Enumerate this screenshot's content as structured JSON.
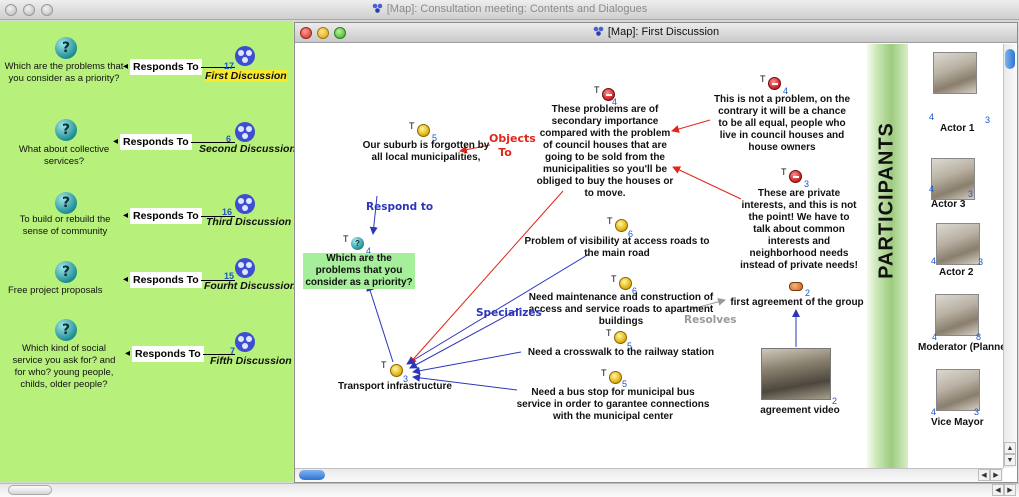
{
  "outer_window": {
    "title": "[Map]: Consultation meeting: Contents and Dialogues"
  },
  "left_panel": {
    "rows": [
      {
        "question": "Which are the problems that you consider as a priority?",
        "link": "Responds To",
        "count": "17",
        "discussion": "First Discussion",
        "highlighted": true
      },
      {
        "question": "What about collective services?",
        "link": "Responds To",
        "count": "6",
        "discussion": "Second Discussion",
        "highlighted": false
      },
      {
        "question": "To build or rebuild the sense of community",
        "link": "Responds To",
        "count": "16",
        "discussion": "Third Discussion",
        "highlighted": false
      },
      {
        "question": "Free project proposals",
        "link": "Responds To",
        "count": "15",
        "discussion": "Fourht Discussion",
        "highlighted": false
      },
      {
        "question": "Which kind of social service you ask for? and for who? young people, childs, older people?",
        "link": "Responds To",
        "count": "7",
        "discussion": "Fifth Discussion",
        "highlighted": false
      }
    ]
  },
  "inner_window": {
    "title": "[Map]: First Discussion"
  },
  "map": {
    "nodes": [
      {
        "id": "suburb",
        "text": "Our suburb is forgotten by all local municipalities,",
        "tag": "T",
        "num": "5",
        "icon": "idea-bulb-icon"
      },
      {
        "id": "secondary",
        "text": "These problems are of secondary importance compared with the problem of council houses that are going to be sold from the municipalities so you'll be obliged to buy the houses or to move.",
        "tag": "T",
        "num": "4",
        "icon": "con-icon"
      },
      {
        "id": "not-problem",
        "text": "This is not a problem, on the contrary it will be a chance to be all equal, people who live in council houses and house owners",
        "tag": "T",
        "num": "4",
        "icon": "con-icon"
      },
      {
        "id": "private",
        "text": "These are private interests, and this is not the point! We have to talk about common interests and neighborhood needs instead of private needs!",
        "tag": "T",
        "num": "3",
        "icon": "con-icon"
      },
      {
        "id": "question",
        "text": "Which are the problems that you consider as a priority?",
        "tag": "T",
        "num": "4",
        "icon": "question-icon"
      },
      {
        "id": "visibility",
        "text": "Problem of visibility at access roads to the main road",
        "tag": "T",
        "num": "6",
        "icon": "idea-bulb-icon"
      },
      {
        "id": "maintenance",
        "text": "Need maintenance and construction of access and service roads to apartment buildings",
        "tag": "T",
        "num": "6",
        "icon": "idea-bulb-icon"
      },
      {
        "id": "crosswalk",
        "text": "Need a crosswalk to the railway station",
        "tag": "T",
        "num": "5",
        "icon": "idea-bulb-icon"
      },
      {
        "id": "bus",
        "text": "Need a bus stop for municipal bus service in order to garantee connections with the municipal center",
        "tag": "T",
        "num": "5",
        "icon": "idea-bulb-icon"
      },
      {
        "id": "transport",
        "text": "Transport infrastructure",
        "tag": "T",
        "num": "3",
        "icon": "idea-bulb-icon"
      },
      {
        "id": "agreement",
        "text": "first agreement of the group",
        "num": "2",
        "icon": "agreement-icon"
      },
      {
        "id": "video",
        "text": "agreement video",
        "num": "2",
        "icon": "video-thumbnail"
      }
    ],
    "link_labels": {
      "objects_to": "Objects To",
      "respond_to": "Respond to",
      "specializes": "Specializes",
      "resolves": "Resolves"
    },
    "colors": {
      "objects": "#e0261a",
      "specializes": "#2b36b8",
      "resolves": "#9a9a9a",
      "highlight": "#a6ef9a"
    }
  },
  "participants": {
    "title": "PARTICIPANTS",
    "people": [
      {
        "name": "Actor 1",
        "left_count": "4",
        "right_count": "3"
      },
      {
        "name": "Actor 3",
        "left_count": "4",
        "right_count": "3"
      },
      {
        "name": "Actor 2",
        "left_count": "4",
        "right_count": "3"
      },
      {
        "name": "Moderator (Planne",
        "left_count": "4",
        "right_count": "8"
      },
      {
        "name": "Vice Mayor",
        "left_count": "4",
        "right_count": "3"
      }
    ]
  }
}
